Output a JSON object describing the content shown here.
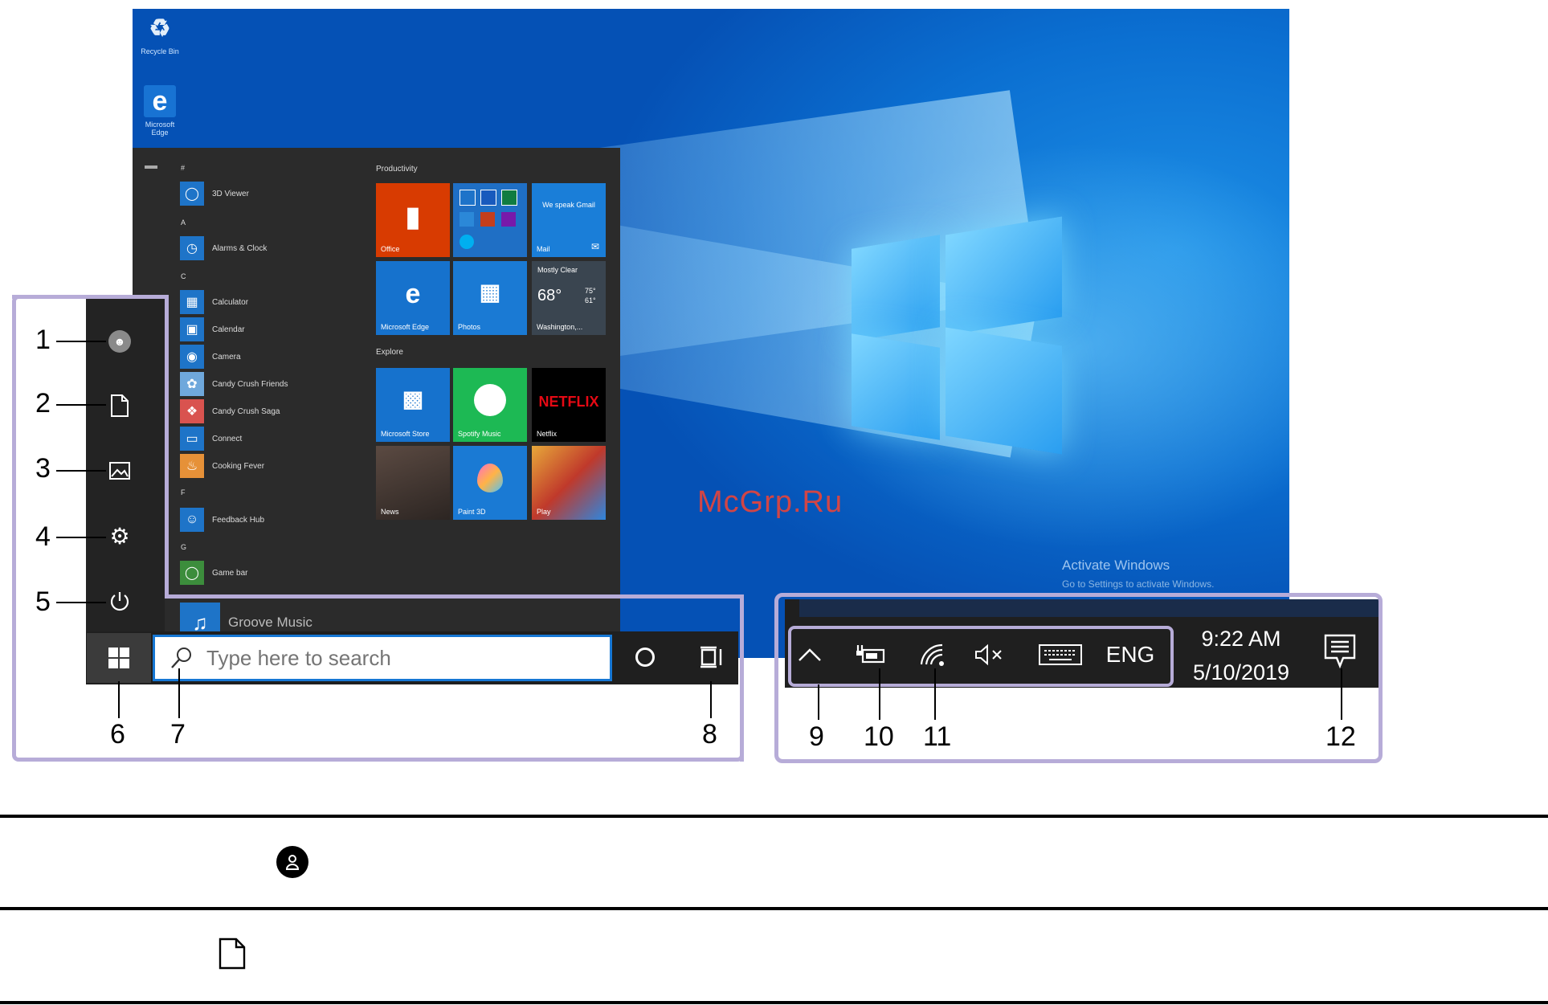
{
  "desktop": {
    "icons": [
      {
        "label": "Recycle Bin",
        "icon": "recycle-bin-icon"
      },
      {
        "label": "Microsoft Edge",
        "icon": "edge-icon"
      }
    ],
    "watermark_line1": "Activate Windows",
    "watermark_line2": "Go to Settings to activate Windows."
  },
  "start_menu": {
    "app_list": [
      {
        "letter": "#",
        "apps": [
          {
            "label": "3D Viewer",
            "icon": "3d-viewer-icon"
          }
        ]
      },
      {
        "letter": "A",
        "apps": [
          {
            "label": "Alarms & Clock",
            "icon": "alarm-clock-icon"
          }
        ]
      },
      {
        "letter": "C",
        "apps": [
          {
            "label": "Calculator",
            "icon": "calculator-icon"
          },
          {
            "label": "Calendar",
            "icon": "calendar-icon"
          },
          {
            "label": "Camera",
            "icon": "camera-icon"
          },
          {
            "label": "Candy Crush Friends",
            "icon": "candy-crush-friends-icon"
          },
          {
            "label": "Candy Crush Saga",
            "icon": "candy-crush-saga-icon"
          },
          {
            "label": "Connect",
            "icon": "connect-icon"
          },
          {
            "label": "Cooking Fever",
            "icon": "cooking-fever-icon"
          }
        ]
      },
      {
        "letter": "F",
        "apps": [
          {
            "label": "Feedback Hub",
            "icon": "feedback-hub-icon"
          }
        ]
      },
      {
        "letter": "G",
        "apps": [
          {
            "label": "Game bar",
            "icon": "game-bar-icon"
          },
          {
            "label": "Groove Music",
            "icon": "groove-music-icon"
          }
        ]
      }
    ],
    "groups": [
      {
        "label": "Productivity"
      },
      {
        "label": "Explore"
      }
    ],
    "tiles": {
      "office": "Office",
      "mail_top": "We speak Gmail",
      "mail": "Mail",
      "edge": "Microsoft Edge",
      "photos": "Photos",
      "weather_title": "Mostly Clear",
      "weather_temp": "68°",
      "weather_hi": "75°",
      "weather_lo": "61°",
      "weather_city": "Washington,...",
      "store": "Microsoft Store",
      "spotify": "Spotify Music",
      "netflix": "NETFLIX",
      "netflix_label": "Netflix",
      "news": "News",
      "paint3d": "Paint 3D",
      "play": "Play"
    },
    "rail_icons": [
      "user-account-icon",
      "documents-icon",
      "pictures-icon",
      "settings-gear-icon",
      "power-icon"
    ]
  },
  "taskbar": {
    "search_placeholder": "Type here to search",
    "tray": {
      "keyboard_language": "ENG",
      "time": "9:22 AM",
      "date": "5/10/2019"
    }
  },
  "callouts": [
    "1",
    "2",
    "3",
    "4",
    "5",
    "6",
    "7",
    "8",
    "9",
    "10",
    "11",
    "12"
  ],
  "site_watermark": "McGrp.Ru",
  "table_icons": [
    "user-account-icon",
    "documents-icon"
  ]
}
